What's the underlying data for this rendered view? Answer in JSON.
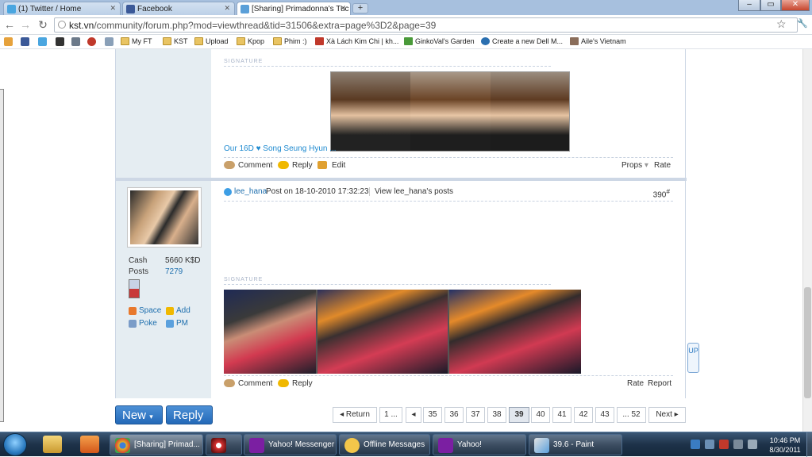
{
  "browser": {
    "tabs": [
      {
        "label": "(1) Twitter / Home",
        "icon": "twitter-icon",
        "active": false
      },
      {
        "label": "Facebook",
        "icon": "facebook-icon",
        "active": false
      },
      {
        "label": "[Sharing] Primadonna's Tuc",
        "icon": "kst-icon",
        "active": true
      }
    ],
    "new_tab": "+",
    "window_controls": [
      "–",
      "▭",
      "✕"
    ],
    "nav": {
      "back": "←",
      "forward": "→",
      "reload": "↻"
    },
    "url_host": "kst.vn",
    "url_path": "/community/forum.php?mod=viewthread&tid=31506&extra=page%3D2&page=39",
    "star": "☆",
    "wrench": "🔧",
    "bookmarks": [
      {
        "label": "My FT",
        "icon": "folder-icon"
      },
      {
        "label": "KST",
        "icon": "folder-icon"
      },
      {
        "label": "Upload",
        "icon": "folder-icon"
      },
      {
        "label": "Kpop",
        "icon": "folder-icon"
      },
      {
        "label": "Phim :)",
        "icon": "folder-icon"
      },
      {
        "label": "Xà Lách Kim Chi | kh...",
        "icon": "site-icon"
      },
      {
        "label": "GinkoVal's Garden",
        "icon": "site-icon"
      },
      {
        "label": "Create a new Dell M...",
        "icon": "site-icon"
      },
      {
        "label": "Aile's Vietnam",
        "icon": "site-icon"
      }
    ]
  },
  "post1": {
    "signature_label": "SIGNATURE",
    "signature_link": "Our 16D ♥ Song Seung Hyun ...",
    "actions": {
      "comment": "Comment",
      "reply": "Reply",
      "edit": "Edit",
      "props": "Props",
      "props_arrow": "▾",
      "rate": "Rate"
    }
  },
  "post2": {
    "author": "lee_hana",
    "posted_on": "Post on 18-10-2010 17:32:23",
    "view_posts": "View lee_hana's posts",
    "floor": "390",
    "floor_sup": "#",
    "stats": {
      "cash_label": "Cash",
      "cash_value": "5660 K$D",
      "posts_label": "Posts",
      "posts_value": "7279"
    },
    "links": {
      "space": "Space",
      "add": "Add",
      "poke": "Poke",
      "pm": "PM"
    },
    "signature_label": "SIGNATURE",
    "actions": {
      "comment": "Comment",
      "reply": "Reply",
      "rate": "Rate",
      "report": "Report"
    }
  },
  "new_button": "New",
  "new_arrow": "▾",
  "reply_button": "Reply",
  "pagination": {
    "return": "Return",
    "return_arrow": "◂",
    "first": "1 ...",
    "prev": "◂",
    "pages": [
      "35",
      "36",
      "37",
      "38",
      "39",
      "40",
      "41",
      "42",
      "43"
    ],
    "current": "39",
    "last": "... 52",
    "next": "Next",
    "next_arrow": "▸"
  },
  "up_button": "UP",
  "taskbar": {
    "tasks": [
      {
        "label": "[Sharing] Primad...",
        "icon": "chrome-icon",
        "active": true
      },
      {
        "label": "",
        "icon": "app-icon",
        "active": false
      },
      {
        "label": "Yahoo! Messenger",
        "icon": "yahoo-icon",
        "active": false
      },
      {
        "label": "Offline Messages",
        "icon": "message-icon",
        "active": false
      },
      {
        "label": "Yahoo!",
        "icon": "yahoo-icon",
        "active": false
      },
      {
        "label": "39.6 - Paint",
        "icon": "paint-icon",
        "active": false
      }
    ],
    "time": "10:46 PM",
    "date": "8/30/2011"
  },
  "colors": {
    "link": "#1e6fae",
    "new_button": "#2f78c4",
    "tab_bar": "#a7c0de",
    "sidebar": "#e5edf2"
  }
}
